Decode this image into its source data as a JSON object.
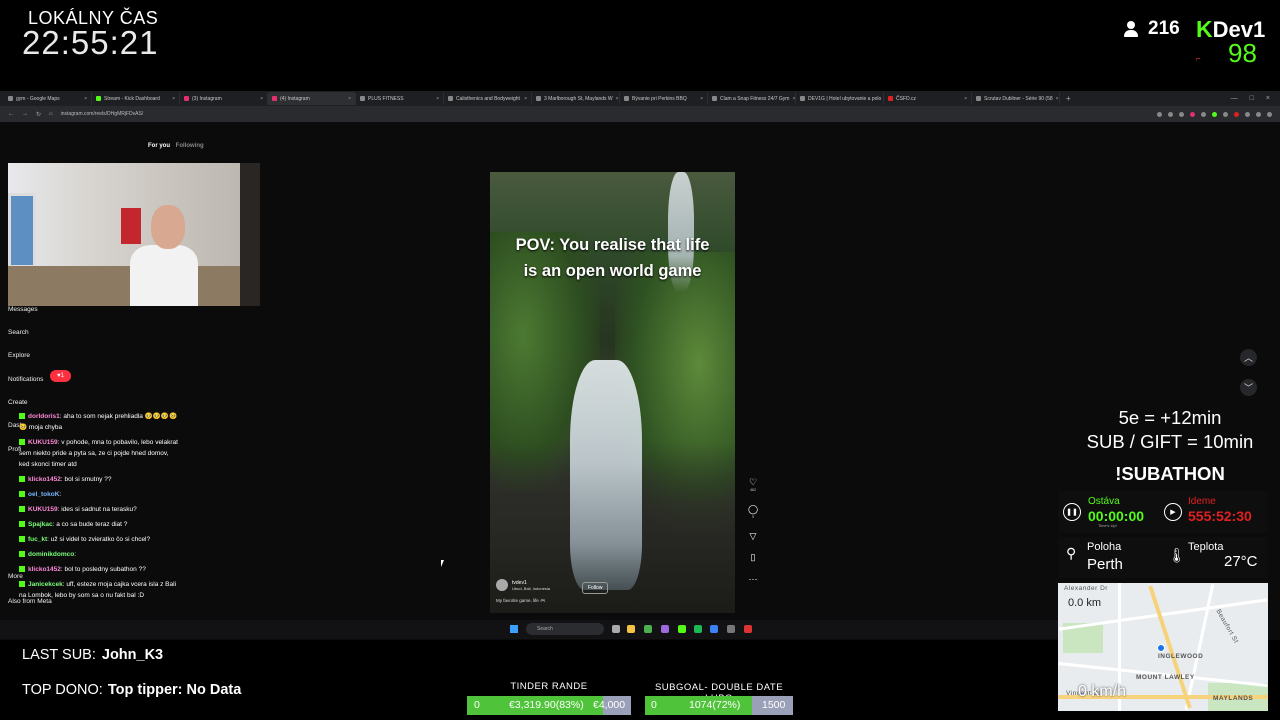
{
  "clock": {
    "label": "LOKÁLNY ČAS",
    "time": "22:55:21"
  },
  "stream": {
    "viewer_icon": "person-icon",
    "viewers": "216",
    "brand_k": "K",
    "brand_name": "Dev1",
    "brand_number": "98",
    "brand_color": "#53fc18"
  },
  "browser": {
    "tabs": [
      {
        "label": "gym - Google Maps"
      },
      {
        "label": "Stream - Kick Dashboard"
      },
      {
        "label": "(3) Instagram"
      },
      {
        "label": "(4) Instagram"
      },
      {
        "label": "PLUS FITNESS"
      },
      {
        "label": "Calisthenics and Bodyweight"
      },
      {
        "label": "3 Marlborough St, Maylands W"
      },
      {
        "label": "Bývanie pri Perkins BBQ"
      },
      {
        "label": "Clam a Snap Fitness 24/7 Gym"
      },
      {
        "label": "DEV1G | Hotel ubytovanie a polo"
      },
      {
        "label": "ČSFD.cz"
      },
      {
        "label": "Scrutav Dubliner - Série 90 (58"
      }
    ],
    "url": "instagram.com/reels/DHgMRjFDvAS/"
  },
  "instagram": {
    "feed_tabs": {
      "for_you": "For you",
      "following": "Following"
    },
    "nav": {
      "messages": "Messages",
      "search": "Search",
      "explore": "Explore",
      "notifications": "Notifications",
      "create": "Create",
      "dashboard": "Dash",
      "profile": "Profi",
      "more": "More",
      "also_from_meta": "Also from Meta"
    },
    "notif_count": "♥1",
    "reel": {
      "caption_line1": "POV: You realise that life",
      "caption_line2": "is an open world game",
      "owner": "tvdev1",
      "location": "Ubud, Bali, Indonesia",
      "follow": "Follow",
      "description": "My favorite game, life 🎮",
      "likes": "462",
      "comments": "9"
    }
  },
  "chat": [
    {
      "user": "dorldoris1",
      "text": ": aha to som nejak prehliadla 🥺🥺🥺🥺🥺 moja chyba",
      "color": "pink"
    },
    {
      "user": "KUKU159",
      "text": ": v pohode, mna to pobavilo, lebo velakrat sem niekto pride a pyta sa, ze ci pojde hned domov, ked skonci timer atd",
      "color": "pink"
    },
    {
      "user": "klicko1452",
      "text": ": bol si smutny ??",
      "color": "pink"
    },
    {
      "user": "oel_tokoK",
      "text": ":",
      "color": "blue"
    },
    {
      "user": "KUKU159",
      "text": ": ides si sadnut na terasku?",
      "color": "pink"
    },
    {
      "user": "Spajkac",
      "text": ": a co sa bude teraz diat ?",
      "color": "green"
    },
    {
      "user": "fuc_kt",
      "text": ": už si videl to zvieratko čo si chcel?",
      "color": "green"
    },
    {
      "user": "dominikdomco",
      "text": ":",
      "color": "green"
    },
    {
      "user": "klicko1452",
      "text": ": bol to posledny subathon ??",
      "color": "pink"
    },
    {
      "user": "Janicekcek",
      "text": ": uff, esteze moja cajka vcera isla z Bali na Lombok, lebo by som sa o nu fakt bal :D",
      "color": "green"
    }
  ],
  "taskbar": {
    "search": "Search"
  },
  "subathon": {
    "rule1": "5e = +12min",
    "rule2": "SUB / GIFT = 10min",
    "title": "!SUBATHON",
    "remaining_label": "Ostáva",
    "remaining_value": "00:00:00",
    "remaining_sub": "Time's Up!",
    "elapsed_label": "Ideme",
    "elapsed_value": "555:52:30",
    "location_label": "Poloha",
    "location_value": "Perth",
    "temp_label": "Teplota",
    "temp_value": "27°C"
  },
  "map": {
    "speed_top": "0.0 km",
    "speed_bottom": "0 km/h",
    "labels": [
      "Alexander Dr",
      "INGLEWOOD",
      "MOUNT LAWLEY",
      "MAYLANDS",
      "Vincent St",
      "Beaufort St"
    ]
  },
  "overlay": {
    "last_sub_label": "LAST SUB:",
    "last_sub_value": "John_K3",
    "top_dono_label": "TOP DONO:",
    "top_dono_value": "Top tipper: No Data"
  },
  "goals": [
    {
      "title": "TINDER RANDE",
      "start": "0",
      "current": "€3,319.90(83%)",
      "target": "€4,000",
      "percent": 83
    },
    {
      "title": "SUBGOAL- DOUBLE DATE LUBO",
      "start": "0",
      "current": "1074(72%)",
      "target": "1500",
      "percent": 72
    }
  ]
}
